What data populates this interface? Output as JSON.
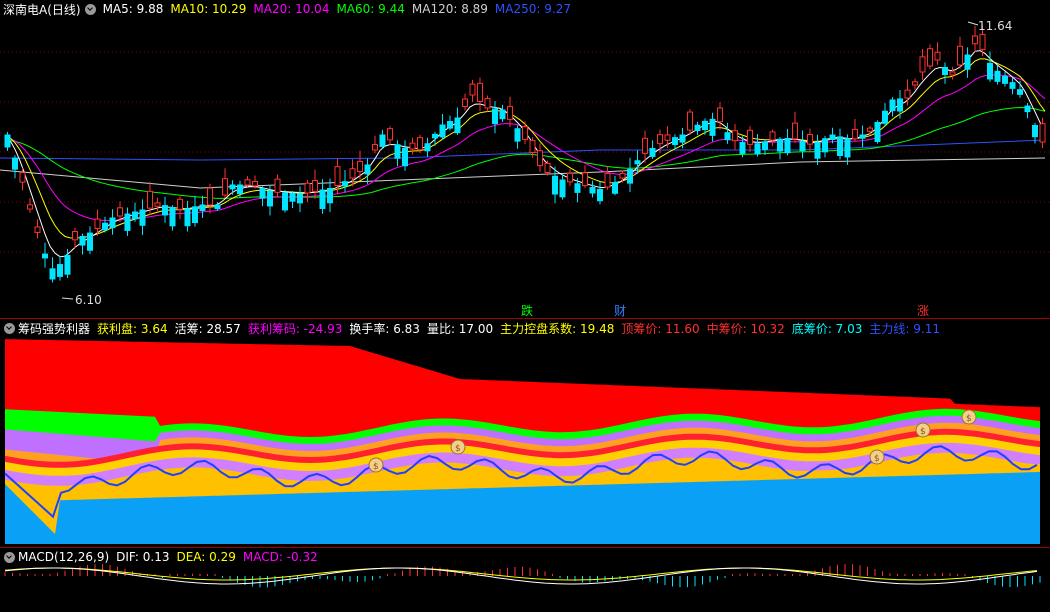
{
  "main": {
    "title": "深南电A(日线)",
    "ma": [
      {
        "label": "MA5: 9.88",
        "color": "#ffffff"
      },
      {
        "label": "MA10: 10.29",
        "color": "#ffff00"
      },
      {
        "label": "MA20: 10.04",
        "color": "#ff00ff"
      },
      {
        "label": "MA60: 9.44",
        "color": "#00ff00"
      },
      {
        "label": "MA120: 8.89",
        "color": "#d0d0d0"
      },
      {
        "label": "MA250: 9.27",
        "color": "#3050ff"
      }
    ],
    "high_label": "11.64",
    "low_label": "6.10",
    "signals": [
      {
        "text": "跌",
        "color": "#00ff00"
      },
      {
        "text": "财",
        "color": "#3080ff"
      },
      {
        "text": "涨",
        "color": "#ff3030"
      }
    ]
  },
  "chip": {
    "title": "筹码强势利器",
    "items": [
      {
        "label": "获利盘: 3.64",
        "color": "#ffff00"
      },
      {
        "label": "活筹: 28.57",
        "color": "#ffffff"
      },
      {
        "label": "获利筹码: -24.93",
        "color": "#ff00ff"
      },
      {
        "label": "换手率: 6.83",
        "color": "#ffffff"
      },
      {
        "label": "量比: 17.00",
        "color": "#ffffff"
      },
      {
        "label": "主力控盘系数: 19.48",
        "color": "#ffff00"
      },
      {
        "label": "顶筹价: 11.60",
        "color": "#ff3030"
      },
      {
        "label": "中筹价: 10.32",
        "color": "#ff3030"
      },
      {
        "label": "底筹价: 7.03",
        "color": "#00ffff"
      },
      {
        "label": "主力线: 9.11",
        "color": "#3050ff"
      }
    ],
    "coin_glyph": "$"
  },
  "macd": {
    "title": "MACD(12,26,9)",
    "items": [
      {
        "label": "DIF: 0.13",
        "color": "#ffffff"
      },
      {
        "label": "DEA: 0.29",
        "color": "#ffff00"
      },
      {
        "label": "MACD: -0.32",
        "color": "#ff00ff"
      }
    ]
  },
  "colors": {
    "up": "#ff3030",
    "down": "#00e5ff",
    "grid": "#800000"
  }
}
